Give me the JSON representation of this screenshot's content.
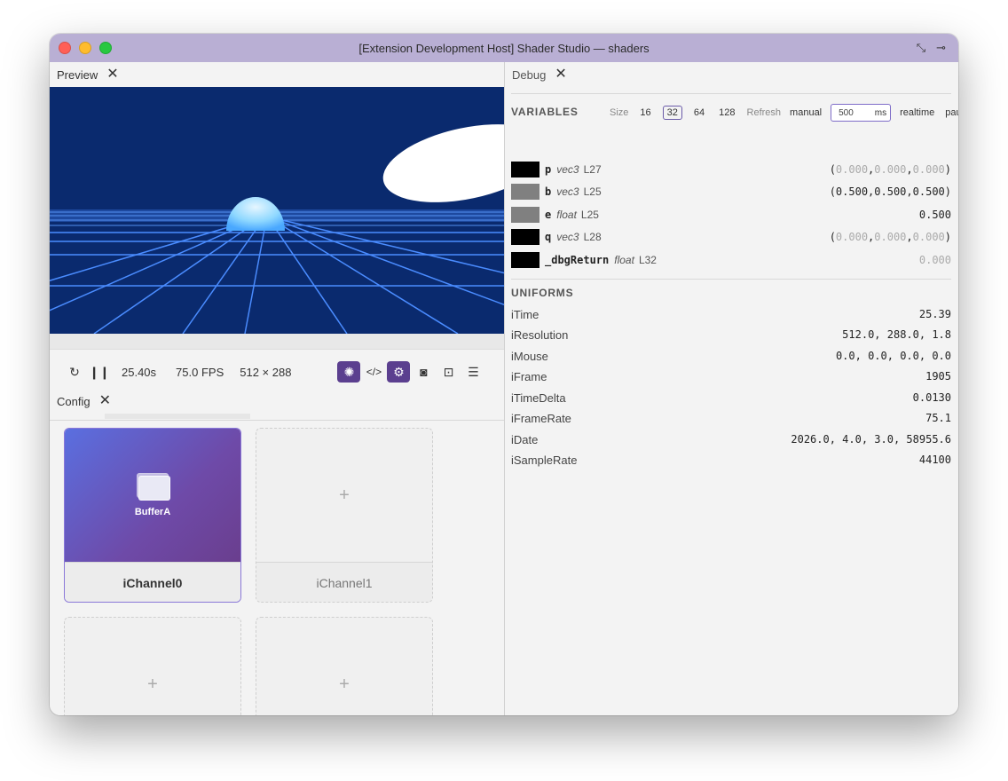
{
  "window": {
    "title": "[Extension Development Host] Shader Studio — shaders"
  },
  "preview": {
    "tab_label": "Preview",
    "time": "25.40s",
    "fps": "75.0 FPS",
    "resolution": "512 × 288"
  },
  "config": {
    "tab_label": "Config",
    "channels": [
      {
        "label": "iChannel0",
        "buffer": "BufferA",
        "add": ""
      },
      {
        "label": "iChannel1",
        "buffer": "",
        "add": "+"
      },
      {
        "label": "",
        "buffer": "",
        "add": "+"
      },
      {
        "label": "",
        "buffer": "",
        "add": "+"
      }
    ]
  },
  "debug": {
    "tab_label": "Debug",
    "variables_title": "VARIABLES",
    "size_label": "Size",
    "sizes": [
      "16",
      "32",
      "64",
      "128"
    ],
    "size_selected": "32",
    "refresh_label": "Refresh",
    "manual_label": "manual",
    "interval_value": "500",
    "interval_unit": "ms",
    "realtime_label": "realtime",
    "pause_label": "pause",
    "variables": [
      {
        "name": "p",
        "type": "vec3",
        "line": "L27",
        "swatch": "#000000",
        "open": "(",
        "v1": "0.000",
        "c1": ",",
        "v2": "0.000",
        "c2": ",",
        "v3": "0.000",
        "close": ")",
        "gray": true
      },
      {
        "name": "b",
        "type": "vec3",
        "line": "L25",
        "swatch": "#808080",
        "open": "(",
        "v1": "0.500",
        "c1": ",",
        "v2": "0.500",
        "c2": ",",
        "v3": "0.500",
        "close": ")",
        "gray": false
      },
      {
        "name": "e",
        "type": "float",
        "line": "L25",
        "swatch": "#808080",
        "value": "0.500"
      },
      {
        "name": "q",
        "type": "vec3",
        "line": "L28",
        "swatch": "#000000",
        "open": "(",
        "v1": "0.000",
        "c1": ",",
        "v2": "0.000",
        "c2": ",",
        "v3": "0.000",
        "close": ")",
        "gray": true
      },
      {
        "name": "_dbgReturn",
        "type": "float",
        "line": "L32",
        "swatch": "#000000",
        "value": "0.000",
        "allgray": true
      }
    ],
    "uniforms_title": "UNIFORMS",
    "uniforms": [
      {
        "name": "iTime",
        "value": "25.39"
      },
      {
        "name": "iResolution",
        "value": "512.0, 288.0, 1.8"
      },
      {
        "name": "iMouse",
        "value": "0.0, 0.0, 0.0, 0.0"
      },
      {
        "name": "iFrame",
        "value": "1905"
      },
      {
        "name": "iTimeDelta",
        "value": "0.0130"
      },
      {
        "name": "iFrameRate",
        "value": "75.1"
      },
      {
        "name": "iDate",
        "value": "2026.0, 4.0, 3.0, 58955.6"
      },
      {
        "name": "iSampleRate",
        "value": "44100"
      }
    ]
  },
  "icons": [
    "restart-icon",
    "pause-icon",
    "bug-icon",
    "code-icon",
    "gear-icon",
    "camera-icon",
    "unlock-icon",
    "menu-icon",
    "close-icon",
    "exit-fullscreen-icon",
    "pin-icon"
  ],
  "colors": {
    "accent": "#5b3f8f",
    "titlebar": "#b9afd4",
    "preview_bg": "#0a2a6e",
    "grid": "#4a8cff"
  }
}
